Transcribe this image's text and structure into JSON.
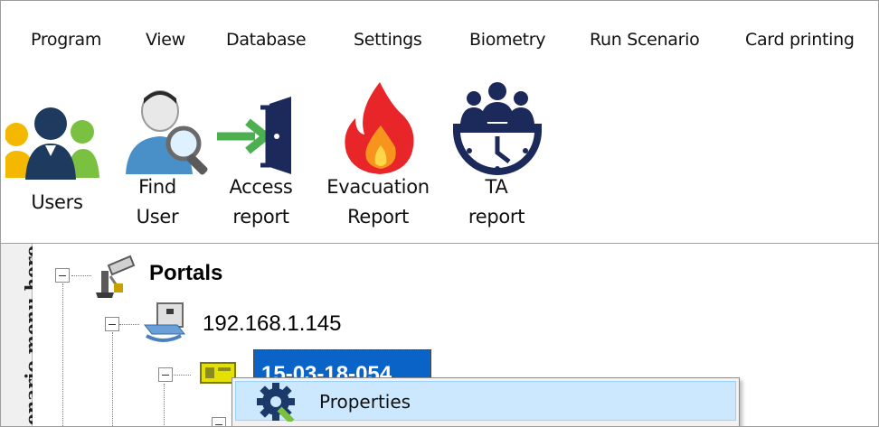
{
  "menu": {
    "items": [
      "Program",
      "View",
      "Database",
      "Settings",
      "Biometry",
      "Run Scenario",
      "Card printing"
    ]
  },
  "toolbar": {
    "buttons": [
      {
        "label": "Users",
        "icon": "users-icon"
      },
      {
        "label": "Find\nUser",
        "icon": "find-user-icon"
      },
      {
        "label": "Access\nreport",
        "icon": "access-report-icon"
      },
      {
        "label": "Evacuation\nReport",
        "icon": "evacuation-fire-icon"
      },
      {
        "label": "TA\nreport",
        "icon": "ta-report-clock-icon"
      }
    ]
  },
  "side_panel": {
    "text": "enario menu here"
  },
  "tree": {
    "root": {
      "label": "Portals",
      "icon": "portals-camera-icon"
    },
    "child": {
      "label": "192.168.1.145",
      "icon": "controller-device-icon"
    },
    "grandchild": {
      "label": "15-03-18-054",
      "icon": "reader-device-icon"
    }
  },
  "context_menu": {
    "items": [
      {
        "label": "Properties",
        "icon": "gear-wrench-icon"
      }
    ]
  },
  "colors": {
    "selection": "#0a64c8",
    "menu_highlight": "#cce8ff",
    "users_icon_primary": "#1f3a5f",
    "users_icon_green": "#7ac142",
    "users_icon_yellow": "#f5b800",
    "access_arrow": "#4caf50",
    "door": "#1b2a5a",
    "fire_red": "#e8262a",
    "fire_orange": "#f7941d",
    "ta_icon": "#1b2a5a"
  }
}
